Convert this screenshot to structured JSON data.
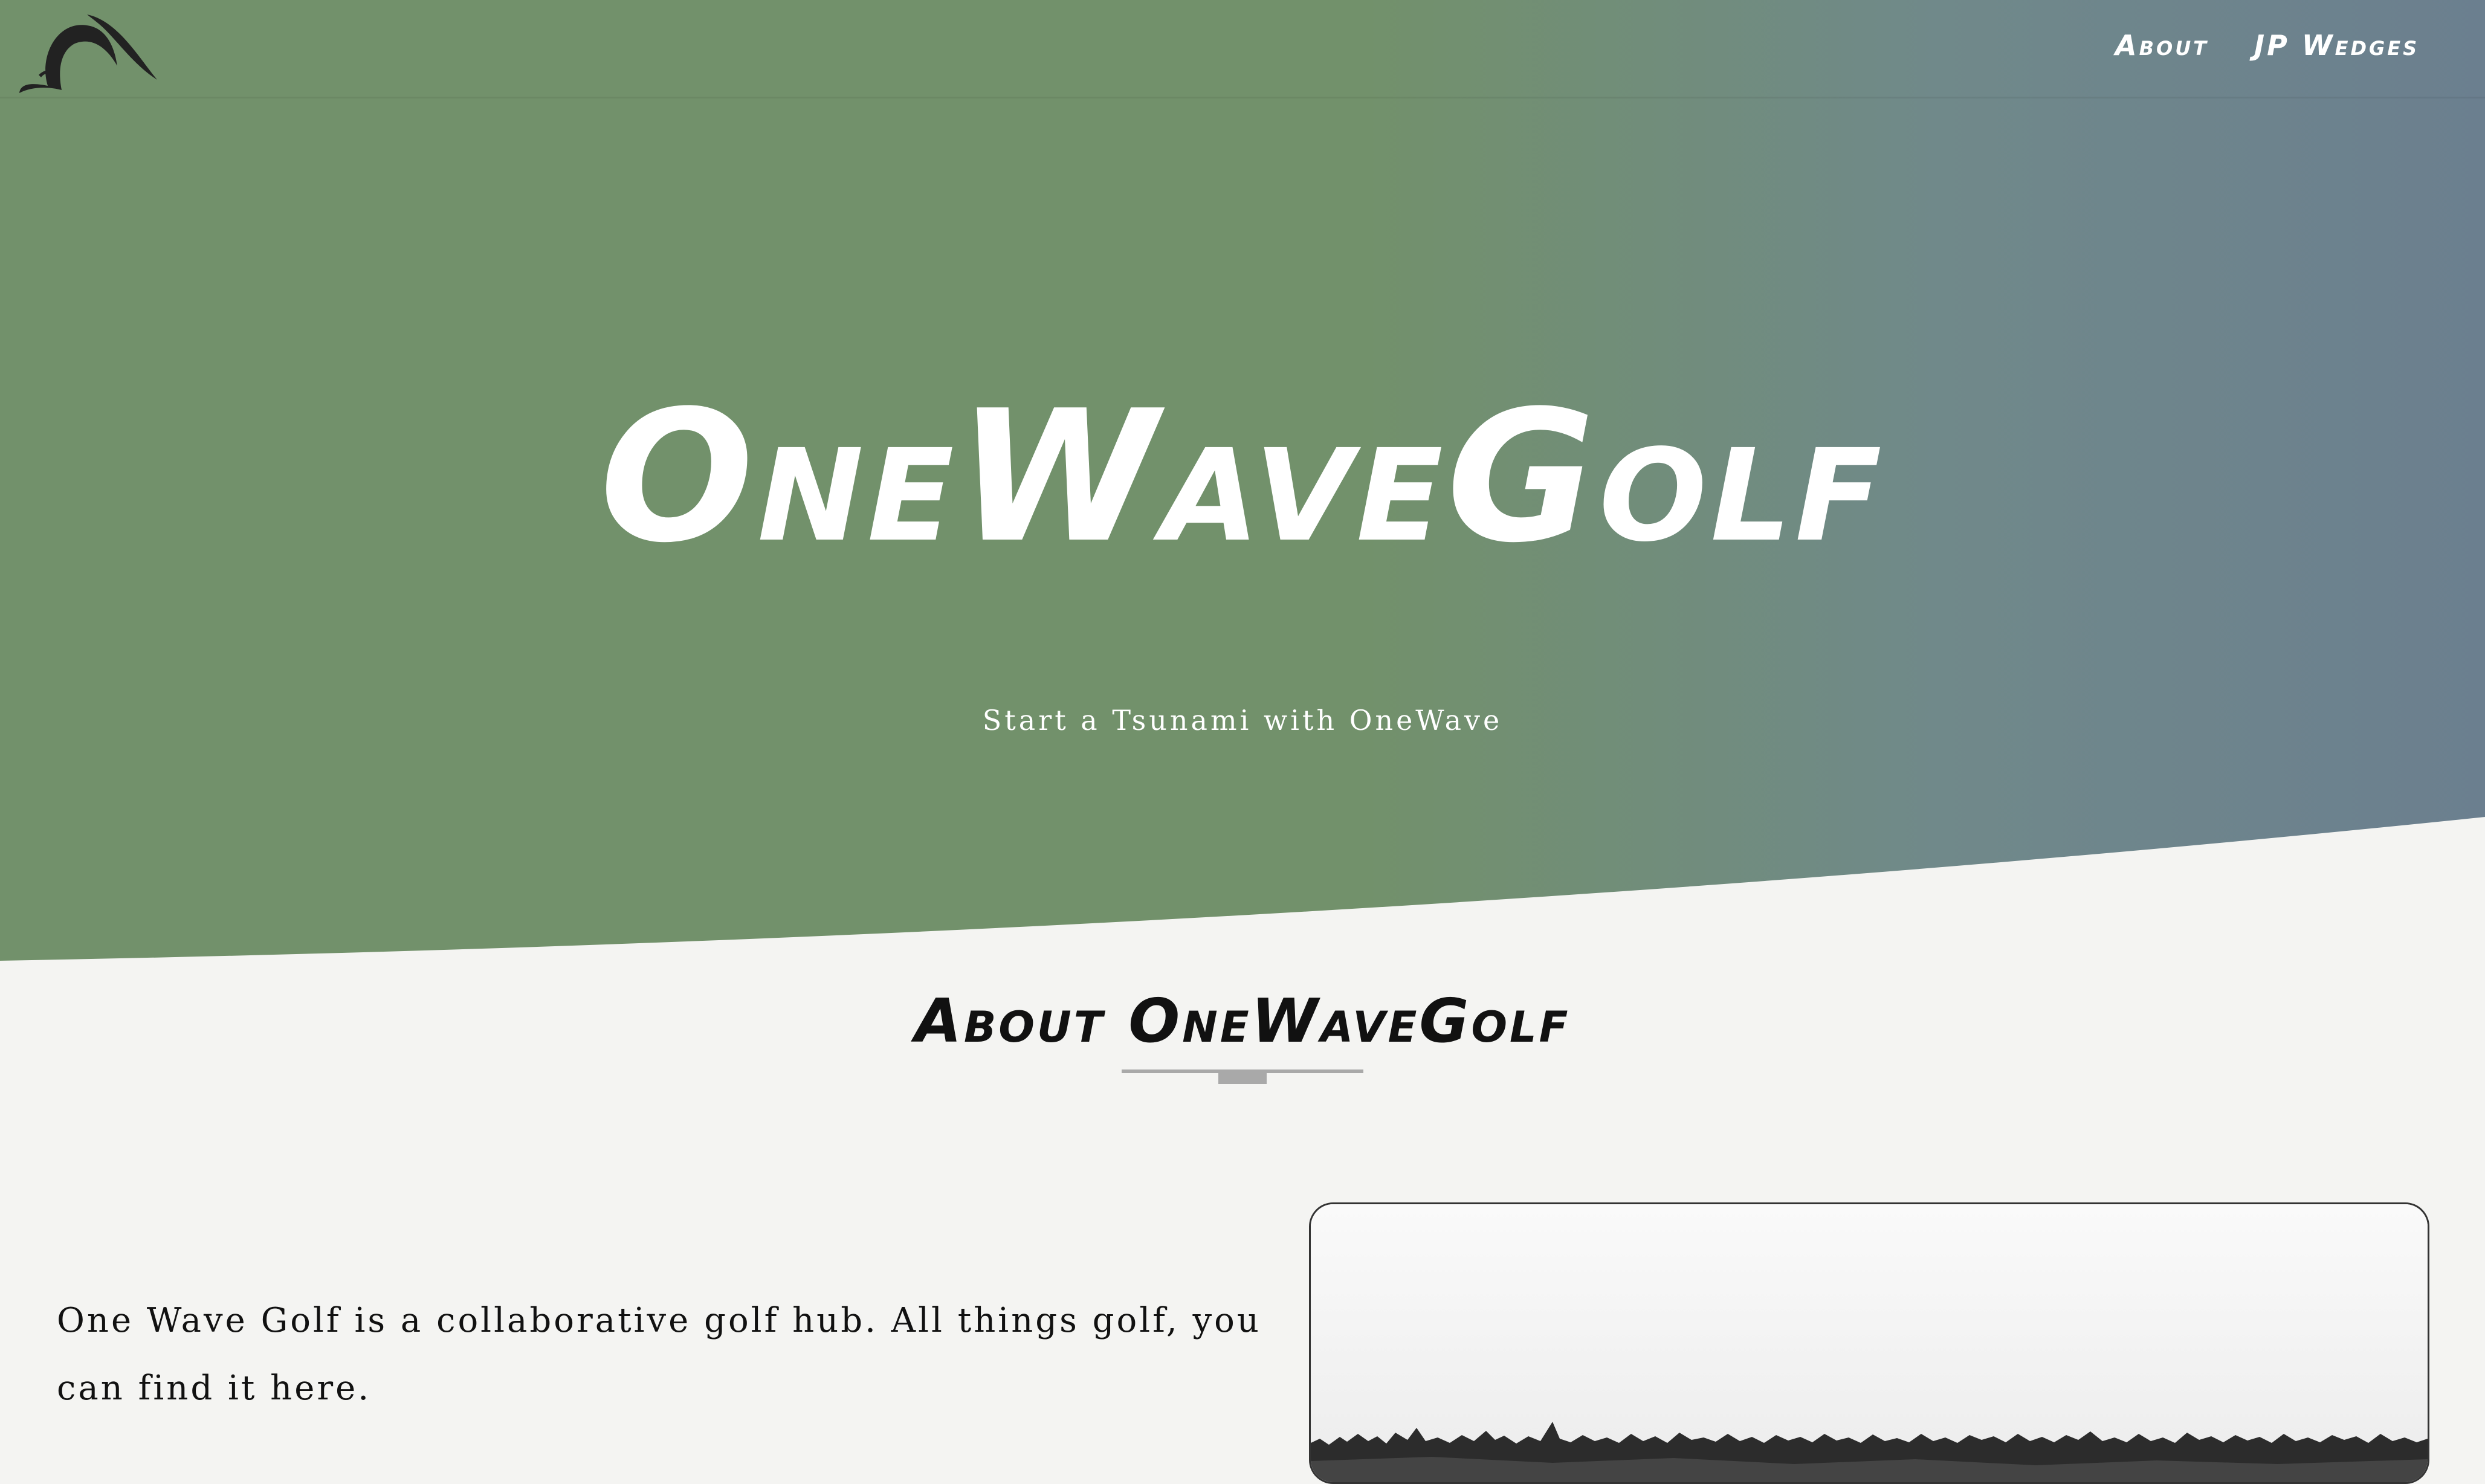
{
  "brand": {
    "logo_icon": "wave-logo-icon"
  },
  "nav": {
    "items": [
      {
        "label": "About"
      },
      {
        "label": "JP Wedges"
      }
    ]
  },
  "hero": {
    "title": "OneWaveGolf",
    "subtitle": "Start a Tsunami with OneWave"
  },
  "about": {
    "title": "About OneWaveGolf",
    "text": "One Wave Golf is a collaborative golf hub. All things golf, you can find it here."
  },
  "colors": {
    "hero_green": "#72916b",
    "hero_blue_gray": "#6b7f8f",
    "page_background": "#f4f4f2",
    "divider": "#a9a9a9"
  }
}
